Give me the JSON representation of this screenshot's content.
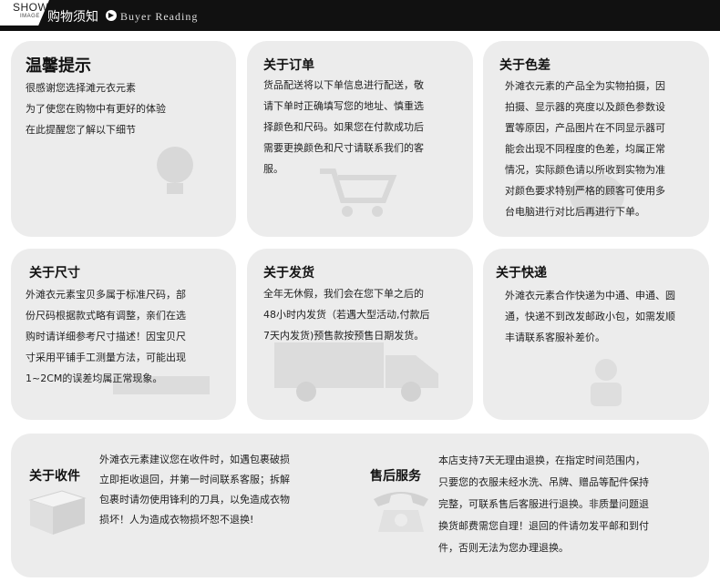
{
  "header": {
    "badge_show": "SHOW",
    "badge_image": "IMAGE",
    "title": "购物须知",
    "subtitle": "Buyer Reading",
    "arrow_icon": "circle-arrow-right-icon"
  },
  "cards": {
    "tips": {
      "title": "温馨提示",
      "lines": [
        "很感谢您选择滩元衣元素",
        "为了使您在购物中有更好的体验",
        "在此提醒您了解以下细节"
      ]
    },
    "order": {
      "title": "关于订单",
      "lines": [
        "货品配送将以下单信息进行配送，敬",
        "请下单时正确填写您的地址、慎重选",
        "择颜色和尺码。如果您在付款成功后",
        "需要更换颜色和尺寸请联系我们的客",
        "服。"
      ]
    },
    "color": {
      "title": "关于色差",
      "lines": [
        "外滩衣元素的产品全为实物拍摄，因",
        "拍摄、显示器的亮度以及颜色参数设",
        "置等原因，产品图片在不同显示器可",
        "能会出现不同程度的色差，均属正常",
        "情况，实际颜色请以所收到实物为准",
        "对颜色要求特别严格的顾客可使用多",
        "台电脑进行对比后再进行下单。"
      ]
    },
    "size": {
      "title": "关于尺寸",
      "lines": [
        "外滩衣元素宝贝多属于标准尺码，部",
        "份尺码根据款式略有调整，亲们在选",
        "购时请详细参考尺寸描述！因宝贝尺",
        "寸采用平铺手工测量方法，可能出现",
        "1~2CM的误差均属正常现象。"
      ]
    },
    "shipping": {
      "title": "关于发货",
      "lines": [
        "全年无休假，我们会在您下单之后的",
        "48小时内发货（若遇大型活动,付款后",
        "7天内发货)预售款按预售日期发货。"
      ]
    },
    "courier": {
      "title": "关于快递",
      "lines": [
        "外滩衣元素合作快递为中通、申通、圆",
        "通，快递不到改发邮政小包，如需发顺",
        "丰请联系客服补差价。"
      ]
    },
    "receiving": {
      "title": "关于收件",
      "lines": [
        "外滩衣元素建议您在收件时，如遇包裹破损",
        "立即拒收退回，并第一时间联系客服；拆解",
        "包裹时请勿使用锋利的刀具，以免造成衣物",
        "损坏！人为造成衣物损坏恕不退换!"
      ]
    },
    "aftersale": {
      "title": "售后服务",
      "lines": [
        "本店支持7天无理由退换，在指定时间范围内，",
        "只要您的衣服未经水洗、吊牌、赠品等配件保持",
        "完整，可联系售后客服进行退换。非质量问题退",
        "换货邮费需您自理！退回的件请勿发平邮和到付",
        "件，否则无法为您办理退换。"
      ]
    }
  },
  "icons": {
    "tips": "lightbulb-icon",
    "order": "cart-icon",
    "color": "palette-icon",
    "size": "ruler-icon",
    "shipping": "delivery-truck-icon",
    "courier": "courier-icon",
    "receiving": "package-box-icon",
    "aftersale": "telephone-icon"
  },
  "colors": {
    "header_bg": "#111111",
    "card_bg": "#ececec",
    "watermark": "#bdbdbd"
  }
}
